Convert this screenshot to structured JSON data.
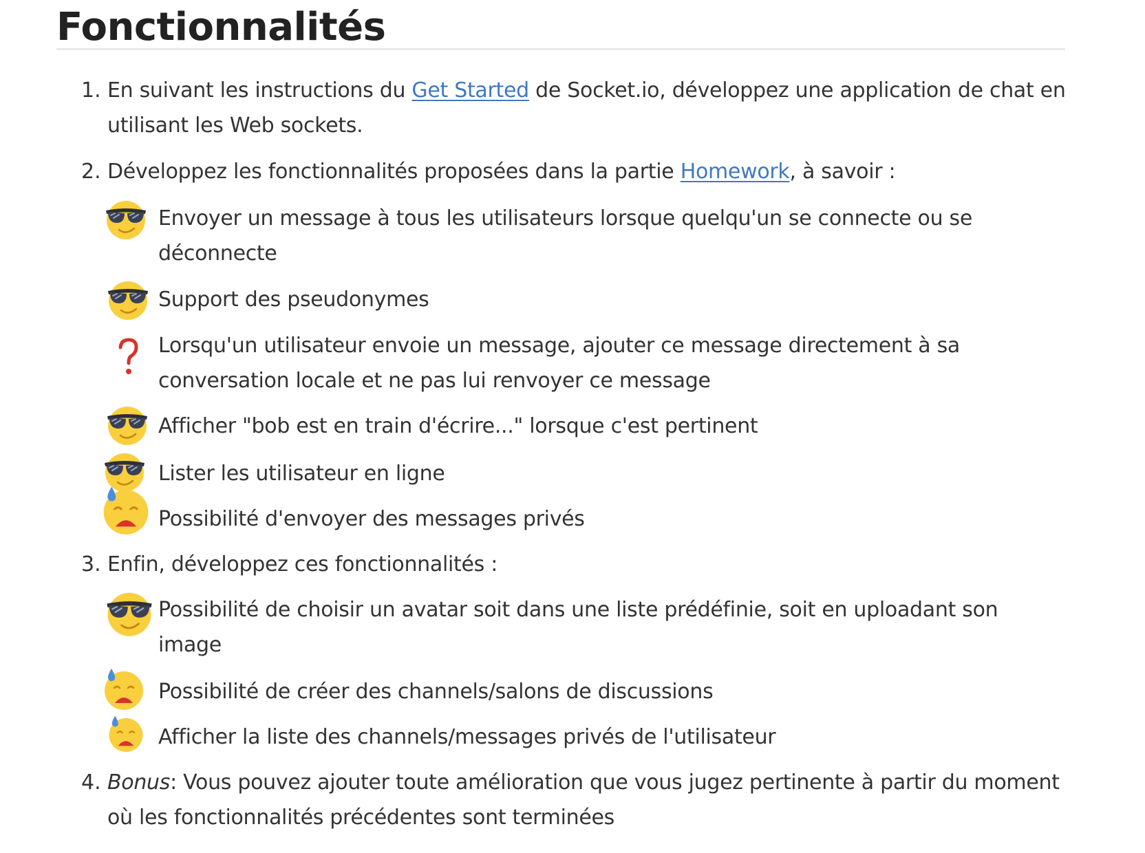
{
  "title": "Fonctionnalités",
  "items": [
    {
      "number": "1.",
      "line1_before": "En suivant les instructions du ",
      "link": "Get Started",
      "line1_after": " de Socket.io, développez une application de chat en",
      "line2": "utilisant les Web sockets."
    },
    {
      "number": "2.",
      "before": "Développez les fonctionnalités proposées dans la partie ",
      "link": "Homework",
      "after": ", à savoir :",
      "subitems": [
        {
          "icon": "sunglasses-face-icon",
          "line1": "Envoyer un message à tous les utilisateurs lorsque quelqu'un se connecte ou se",
          "line2": "déconnecte"
        },
        {
          "icon": "sunglasses-face-icon",
          "line1": "Support des pseudonymes"
        },
        {
          "icon": "red-question-mark-icon",
          "line1": "Lorsqu'un utilisateur envoie un message, ajouter ce message directement à sa",
          "line2": "conversation locale et ne pas lui renvoyer ce message"
        },
        {
          "icon": "sunglasses-face-icon",
          "line1": "Afficher \"bob est en train d'écrire...\" lorsque c'est pertinent"
        },
        {
          "icon": "sunglasses-face-icon",
          "line1": "Lister les utilisateur en ligne"
        },
        {
          "icon": "sweating-sad-face-icon",
          "line1": "Possibilité d'envoyer des messages privés"
        }
      ]
    },
    {
      "number": "3.",
      "text": "Enfin, développez ces fonctionnalités :",
      "subitems": [
        {
          "icon": "sunglasses-face-icon",
          "line1": "Possibilité de choisir un avatar soit dans une liste prédéfinie, soit en uploadant son",
          "line2": "image"
        },
        {
          "icon": "sweating-sad-face-icon",
          "line1": "Possibilité de créer des channels/salons de discussions"
        },
        {
          "icon": "sweating-sad-face-icon",
          "line1": "Afficher la liste des channels/messages privés de l'utilisateur"
        }
      ]
    },
    {
      "number": "4.",
      "bonus_label": "Bonus",
      "line1": ": Vous pouvez ajouter toute amélioration que vous jugez pertinente à partir du moment",
      "line2": "où les fonctionnalités précédentes sont terminées"
    }
  ]
}
